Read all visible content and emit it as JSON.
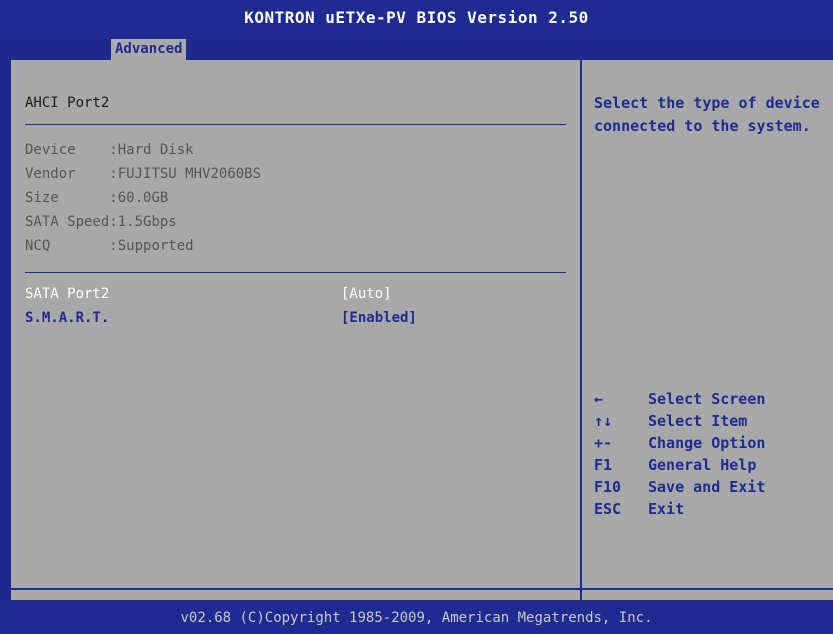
{
  "header": {
    "title": "KONTRON uETXe-PV BIOS Version 2.50",
    "active_tab": "Advanced"
  },
  "page": {
    "section_title": "AHCI Port2",
    "info": [
      {
        "label": "Device    ",
        "value": ":Hard Disk"
      },
      {
        "label": "Vendor    ",
        "value": ":FUJITSU MHV2060BS"
      },
      {
        "label": "Size      ",
        "value": ":60.0GB"
      },
      {
        "label": "SATA Speed",
        "value": ":1.5Gbps"
      },
      {
        "label": "NCQ       ",
        "value": ":Supported"
      }
    ],
    "options": [
      {
        "label": "SATA Port2",
        "value": "[Auto]"
      },
      {
        "label": "S.M.A.R.T.",
        "value": "[Enabled]"
      }
    ]
  },
  "help": {
    "text": "Select the type of device connected to the system.",
    "keys": [
      {
        "key": "←",
        "desc": "Select Screen"
      },
      {
        "key": "↑↓",
        "desc": "Select Item"
      },
      {
        "key": "+-",
        "desc": "Change Option"
      },
      {
        "key": "F1",
        "desc": "General Help"
      },
      {
        "key": "F10",
        "desc": "Save and Exit"
      },
      {
        "key": "ESC",
        "desc": "Exit"
      }
    ]
  },
  "footer": {
    "copyright": "v02.68 (C)Copyright 1985-2009, American Megatrends, Inc."
  },
  "colors": {
    "bios_blue": "#1f2b90",
    "panel_gray": "#a8a8a8",
    "selected_text": "#ffffff"
  }
}
